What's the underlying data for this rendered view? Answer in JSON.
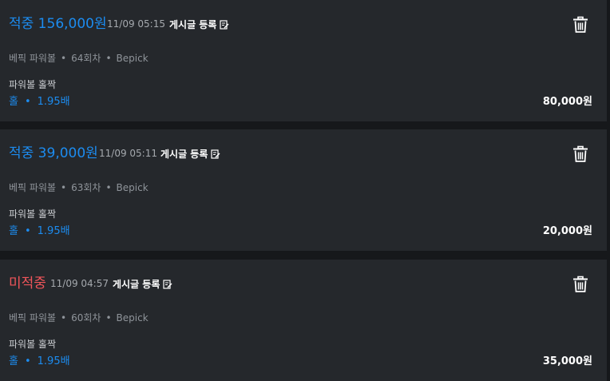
{
  "bets": [
    {
      "result": "적중 156,000원",
      "result_type": "hit",
      "time": "11/09 05:15",
      "post_label": "게시글 등록",
      "game": "베픽 파워볼",
      "round": "64회차",
      "site": "Bepick",
      "bet_type": "파워볼 홀짝",
      "pick": "홀",
      "odds": "1.95배",
      "amount": "80,000원"
    },
    {
      "result": "적중 39,000원",
      "result_type": "hit",
      "time": "11/09 05:11",
      "post_label": "게시글 등록",
      "game": "베픽 파워볼",
      "round": "63회차",
      "site": "Bepick",
      "bet_type": "파워볼 홀짝",
      "pick": "홀",
      "odds": "1.95배",
      "amount": "20,000원"
    },
    {
      "result": "미적중",
      "result_type": "miss",
      "time": "11/09 04:57",
      "post_label": "게시글 등록",
      "game": "베픽 파워볼",
      "round": "60회차",
      "site": "Bepick",
      "bet_type": "파워볼 홀짝",
      "pick": "홀",
      "odds": "1.95배",
      "amount": "35,000원"
    }
  ],
  "icons": {
    "post": "edit-note-icon",
    "delete": "trash-icon"
  },
  "colors": {
    "hit": "#1c8cf0",
    "miss": "#f0555a",
    "card_bg": "#25282c"
  }
}
